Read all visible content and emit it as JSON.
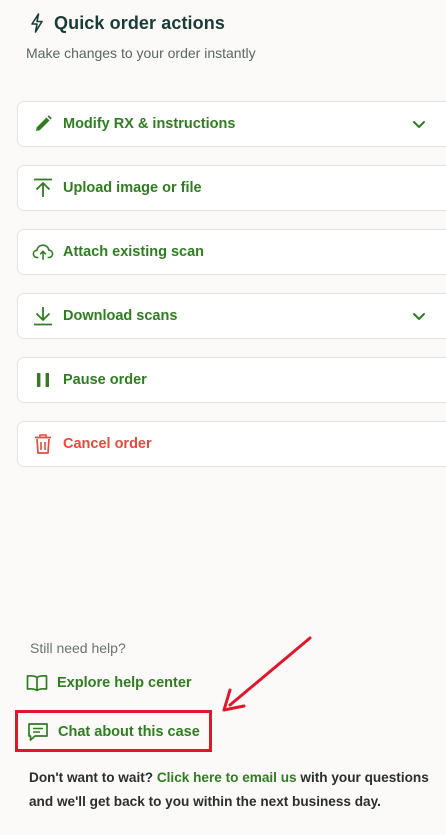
{
  "header": {
    "icon": "lightning-bolt-icon",
    "title": "Quick order actions",
    "subtitle": "Make changes to your order instantly"
  },
  "actions": [
    {
      "label": "Modify RX & instructions",
      "icon": "pencil-icon",
      "expandable": true
    },
    {
      "label": "Upload image or file",
      "icon": "upload-icon",
      "expandable": false
    },
    {
      "label": "Attach existing scan",
      "icon": "cloud-upload-icon",
      "expandable": false
    },
    {
      "label": "Download scans",
      "icon": "download-icon",
      "expandable": true
    },
    {
      "label": "Pause order",
      "icon": "pause-icon",
      "expandable": false
    },
    {
      "label": "Cancel order",
      "icon": "trash-icon",
      "expandable": false,
      "destructive": true
    }
  ],
  "help": {
    "heading": "Still need help?",
    "explore_label": "Explore help center",
    "chat_label": "Chat about this case"
  },
  "footer": {
    "prefix": "Don't want to wait? ",
    "email_link": "Click here to email us",
    "suffix": " with your questions and we'll get back to you within the next business day."
  },
  "colors": {
    "accent_green": "#2f7d20",
    "danger_red": "#e34b3c",
    "highlight_red": "#e0162b",
    "title_dark": "#193c37"
  }
}
